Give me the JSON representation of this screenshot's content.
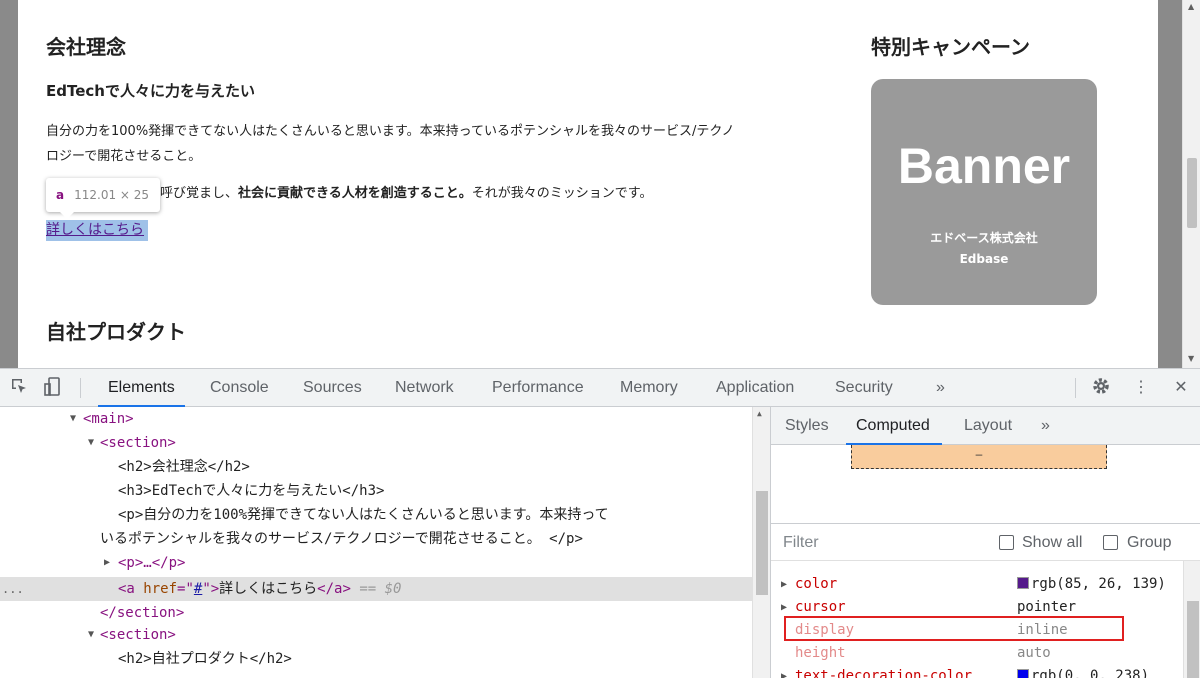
{
  "page": {
    "section1": {
      "heading": "会社理念",
      "subheading": "EdTechで人々に力を与えたい",
      "para1_line1": "自分の力を100%発揮できてない人はたくさんいると思います。本来持っているポテンシャルを我々のサービス/テクノ",
      "para1_line2": "ロジーで開花させること。",
      "para2_pre": "呼び覚まし、",
      "para2_bold": "社会に貢献できる人材を創造すること。",
      "para2_post": "それが我々のミッションです。",
      "link": "詳しくはこちら"
    },
    "section2": {
      "heading": "自社プロダクト"
    },
    "sidebar": {
      "heading": "特別キャンペーン",
      "banner_title": "Banner",
      "banner_company": "エドベース株式会社",
      "banner_company_en": "Edbase"
    },
    "tooltip": {
      "tag": "a",
      "dims": "112.01 × 25"
    }
  },
  "devtools": {
    "tabs": [
      "Elements",
      "Console",
      "Sources",
      "Network",
      "Performance",
      "Memory",
      "Application",
      "Security",
      "»"
    ],
    "active_tab": "Elements",
    "toolbar_icons": [
      "inspect-icon",
      "device-toggle-icon",
      "settings-icon",
      "more-icon",
      "close-icon"
    ],
    "dom": {
      "main_open": "<main>",
      "section_open": "<section>",
      "h2_line": "<h2>会社理念</h2>",
      "h3_line": "<h3>EdTechで人々に力を与えたい</h3>",
      "p_line1": "<p>自分の力を100%発揮できてない人はたくさんいると思います。本来持って",
      "p_line2": "いるポテンシャルを我々のサービス/テクノロジーで開花させること。 </p>",
      "p_collapsed": "<p>…</p>",
      "a_open": "<a ",
      "a_attr": "href",
      "a_eq": "=\"",
      "a_val": "#",
      "a_close_q": "\">",
      "a_text": "詳しくはこちら",
      "a_close": "</a>",
      "a_marker": "== $0",
      "dots": "...",
      "section_close": "</section>",
      "section2_open": "<section>",
      "h2_product": "<h2>自社プロダクト</h2>"
    },
    "side": {
      "tabs": [
        "Styles",
        "Computed",
        "Layout",
        "»"
      ],
      "active_tab": "Computed",
      "boxmodel_value": "–",
      "filter_placeholder": "Filter",
      "show_all": "Show all",
      "group": "Group",
      "properties": [
        {
          "name": "color",
          "value": "rgb(85, 26, 139)",
          "swatch": "#551a8b",
          "expandable": true,
          "inherited": false
        },
        {
          "name": "cursor",
          "value": "pointer",
          "expandable": true,
          "inherited": false
        },
        {
          "name": "display",
          "value": "inline",
          "expandable": false,
          "inherited": true
        },
        {
          "name": "height",
          "value": "auto",
          "expandable": false,
          "inherited": true
        },
        {
          "name": "text-decoration-color",
          "value": "rgb(0, 0, 238)",
          "swatch": "#0000ee",
          "expandable": true,
          "inherited": false
        }
      ]
    }
  }
}
